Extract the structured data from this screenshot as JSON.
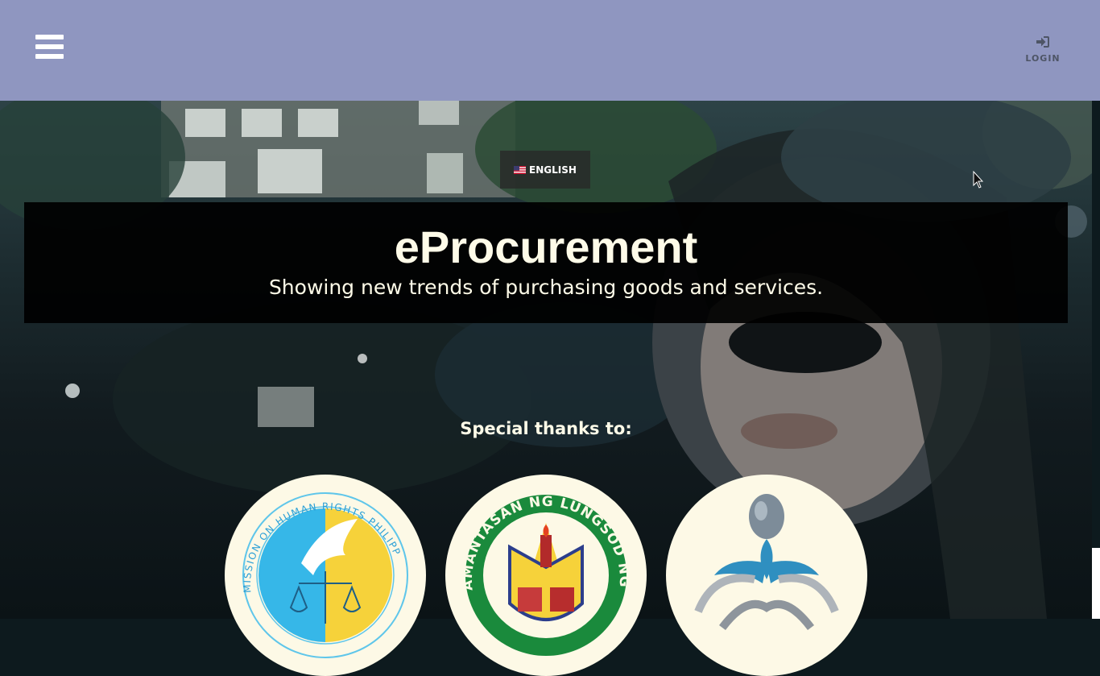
{
  "header": {
    "menu_icon": "hamburger-menu-icon",
    "login_icon": "sign-in-icon",
    "login_label": "LOGIN",
    "background_color": "#8f96c0"
  },
  "language": {
    "label": "ENGLISH",
    "flag_icon": "us-flag-icon"
  },
  "hero": {
    "title": "eProcurement",
    "subtitle": "Showing new trends of purchasing goods and services.",
    "title_color": "#fefbe8"
  },
  "partners": {
    "heading": "Special thanks to:",
    "logos": [
      {
        "name": "human-rights-commission-logo",
        "seal_text": "MISSION ON HUMAN RIGHTS PHILIPP"
      },
      {
        "name": "pamantasan-lungsod-logo",
        "seal_text": "AMANTASAN NG LUNGSOD NG PAS"
      },
      {
        "name": "chain-figure-logo"
      }
    ],
    "badge_color": "#fdf9e6"
  }
}
